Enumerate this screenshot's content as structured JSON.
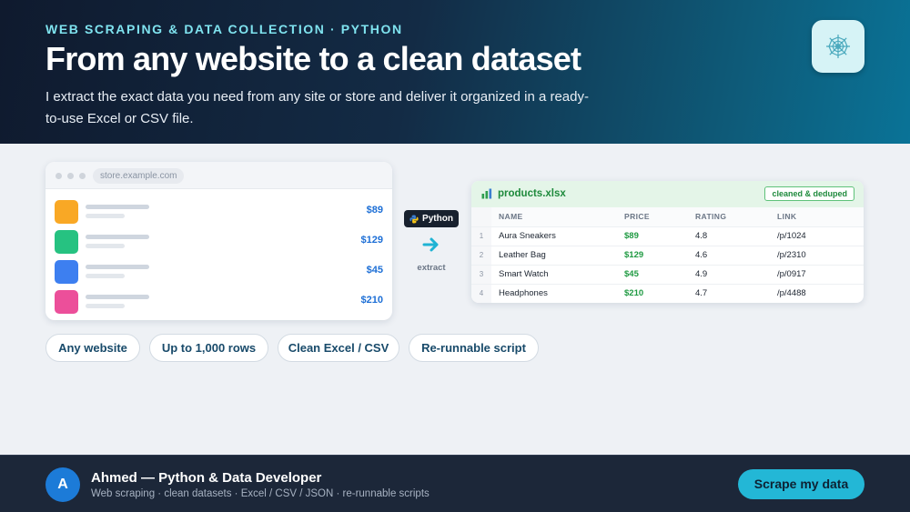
{
  "header": {
    "eyebrow": "WEB SCRAPING & DATA COLLECTION · PYTHON",
    "title": "From any website to a clean dataset",
    "subtitle": "I extract the exact data you need from any site or store and deliver it organized in a ready-to-use Excel or CSV file.",
    "badge_icon": "spider-web-icon"
  },
  "browser": {
    "url": "store.example.com",
    "products": [
      {
        "price": "$89",
        "color": "#f9a825"
      },
      {
        "price": "$129",
        "color": "#26c281"
      },
      {
        "price": "$45",
        "color": "#3d7ff0"
      },
      {
        "price": "$210",
        "color": "#ec4f9a"
      }
    ]
  },
  "pipeline": {
    "badge": "Python",
    "arrow_icon": "right-arrow-icon",
    "label": "extract"
  },
  "sheet": {
    "file_name": "products.xlsx",
    "tag": "cleaned & deduped",
    "columns": [
      "NAME",
      "PRICE",
      "RATING",
      "LINK"
    ],
    "rows": [
      {
        "idx": "1",
        "name": "Aura Sneakers",
        "price": "$89",
        "rating": "4.8",
        "link": "/p/1024"
      },
      {
        "idx": "2",
        "name": "Leather Bag",
        "price": "$129",
        "rating": "4.6",
        "link": "/p/2310"
      },
      {
        "idx": "3",
        "name": "Smart Watch",
        "price": "$45",
        "rating": "4.9",
        "link": "/p/0917"
      },
      {
        "idx": "4",
        "name": "Headphones",
        "price": "$210",
        "rating": "4.7",
        "link": "/p/4488"
      }
    ]
  },
  "features": [
    "Any website",
    "Up to 1,000 rows",
    "Clean Excel / CSV",
    "Re-runnable script"
  ],
  "footer": {
    "avatar_initial": "A",
    "name": "Ahmed — Python & Data Developer",
    "tagline": "Web scraping · clean datasets · Excel / CSV / JSON · re-runnable scripts",
    "cta": "Scrape my data"
  },
  "colors": {
    "accent": "#23b7d6",
    "excel_green": "#1e8a3c",
    "price_blue": "#1d6fd6"
  }
}
